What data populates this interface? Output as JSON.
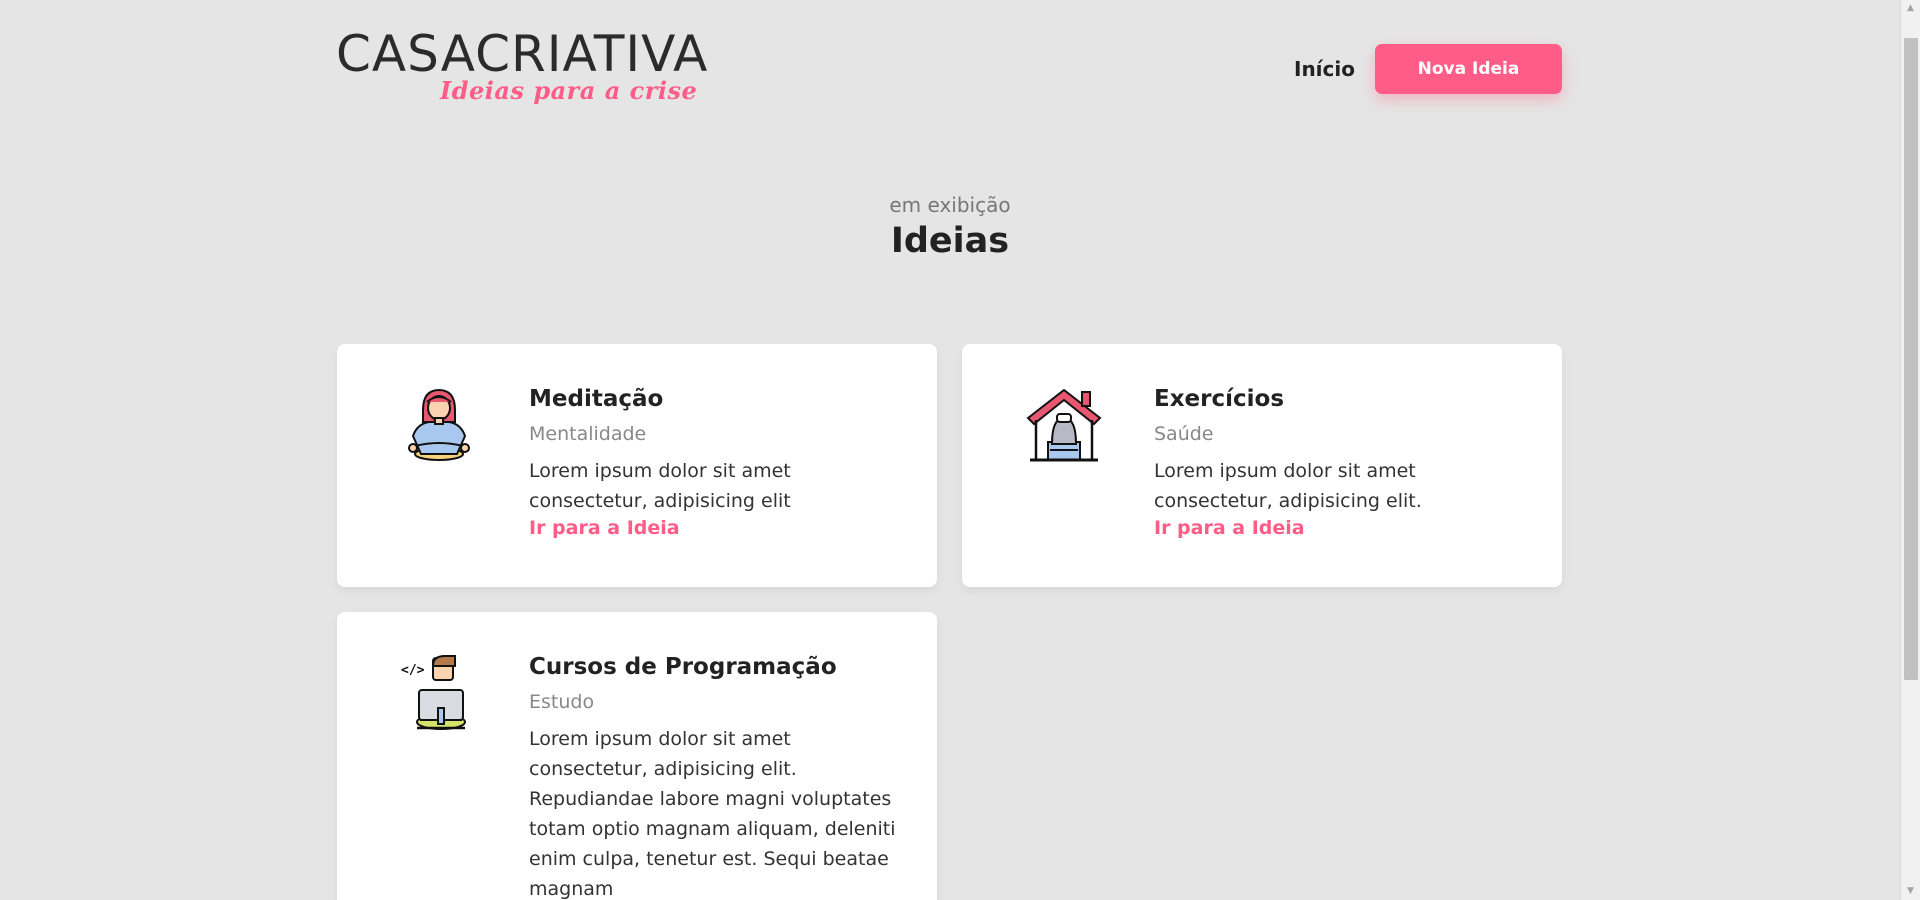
{
  "header": {
    "logo_main_bold": "CASA",
    "logo_main_rest": "CRIATIVA",
    "logo_tagline": "Ideias para a crise",
    "nav_home": "Início",
    "new_idea_button": "Nova Ideia"
  },
  "section": {
    "subtitle": "em exibição",
    "title": "Ideias"
  },
  "ideas": [
    {
      "icon": "meditation-icon",
      "title": "Meditação",
      "category": "Mentalidade",
      "description": "Lorem ipsum dolor sit amet consectetur, adipisicing elit",
      "link": "Ir para a Ideia"
    },
    {
      "icon": "home-gym-icon",
      "title": "Exercícios",
      "category": "Saúde",
      "description": "Lorem ipsum dolor sit amet consectetur, adipisicing elit.",
      "link": "Ir para a Ideia"
    },
    {
      "icon": "programmer-icon",
      "title": "Cursos de Programação",
      "category": "Estudo",
      "description": "Lorem ipsum dolor sit amet consectetur, adipisicing elit. Repudiandae labore magni voluptates totam optio magnam aliquam, deleniti enim culpa, tenetur est. Sequi beatae magnam"
    }
  ],
  "colors": {
    "accent": "#ff5c87",
    "background": "#e5e5e5",
    "card": "#ffffff",
    "text": "#222222",
    "muted": "#888888"
  }
}
